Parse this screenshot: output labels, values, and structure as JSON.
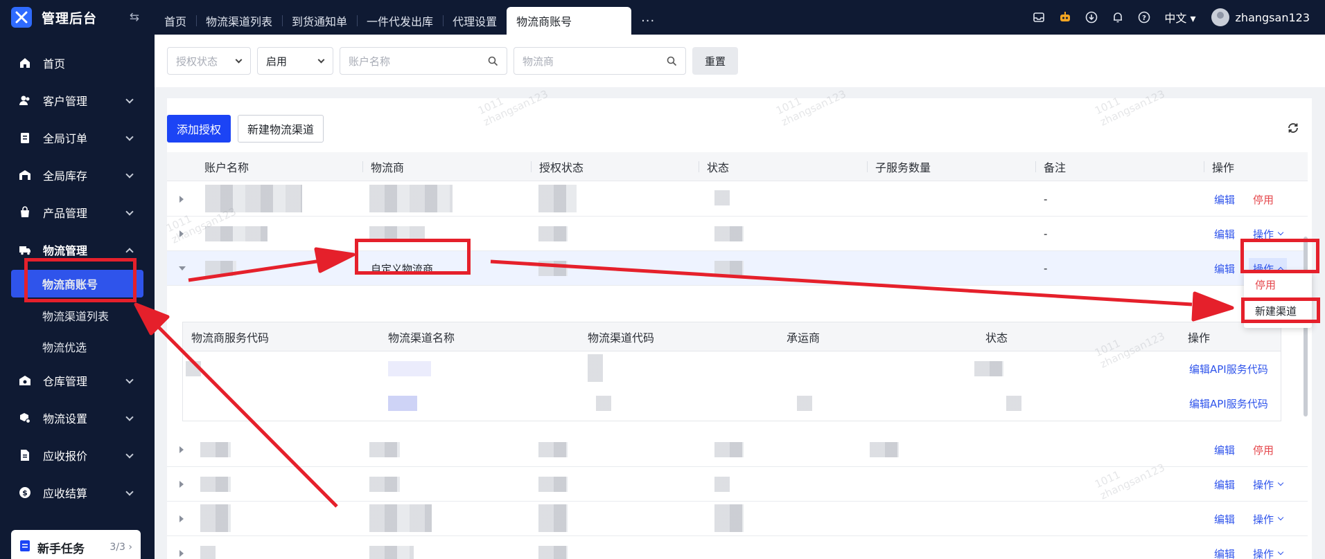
{
  "app": {
    "title": "管理后台"
  },
  "tabs": [
    {
      "label": "首页"
    },
    {
      "label": "物流渠道列表"
    },
    {
      "label": "到货通知单"
    },
    {
      "label": "一件代发出库"
    },
    {
      "label": "代理设置"
    },
    {
      "label": "物流商账号",
      "active": true
    }
  ],
  "header": {
    "language": "中文",
    "username": "zhangsan123"
  },
  "sidebar": {
    "items": [
      {
        "label": "首页",
        "icon": "home-icon"
      },
      {
        "label": "客户管理",
        "icon": "users-icon"
      },
      {
        "label": "全局订单",
        "icon": "clipboard-icon"
      },
      {
        "label": "全局库存",
        "icon": "warehouse-icon"
      },
      {
        "label": "产品管理",
        "icon": "bag-icon"
      },
      {
        "label": "物流管理",
        "icon": "truck-icon",
        "open": true
      },
      {
        "label": "仓库管理",
        "icon": "storehouse-icon"
      },
      {
        "label": "物流设置",
        "icon": "box-gear-icon"
      },
      {
        "label": "应收报价",
        "icon": "document-icon"
      },
      {
        "label": "应收结算",
        "icon": "coin-icon"
      }
    ],
    "sub_items": [
      {
        "label": "物流商账号",
        "active": true
      },
      {
        "label": "物流渠道列表"
      },
      {
        "label": "物流优选"
      }
    ],
    "task": {
      "label": "新手任务",
      "count": "3/3"
    }
  },
  "filters": {
    "auth_status_placeholder": "授权状态",
    "status_value": "启用",
    "account_placeholder": "账户名称",
    "carrier_placeholder": "物流商",
    "reset_label": "重置"
  },
  "toolbar": {
    "add_auth_label": "添加授权",
    "new_channel_label": "新建物流渠道"
  },
  "table": {
    "columns": [
      "账户名称",
      "物流商",
      "授权状态",
      "状态",
      "子服务数量",
      "备注",
      "操作"
    ],
    "remark_placeholder": "-",
    "edit_label": "编辑",
    "disable_label": "停用",
    "op_label": "操作",
    "custom_carrier": "自定义物流商"
  },
  "subtable": {
    "columns": [
      "物流商服务代码",
      "物流渠道名称",
      "物流渠道代码",
      "承运商",
      "状态",
      "操作"
    ],
    "edit_api_label": "编辑API服务代码"
  },
  "dropdown": {
    "items": [
      "停用",
      "新建渠道"
    ]
  },
  "watermark": {
    "line1": "1011",
    "line2": "zhangsan123"
  },
  "colors": {
    "primary": "#1c44f5",
    "sidebar": "#0f1a33",
    "danger": "#e5484d",
    "annotation": "#e5202b"
  }
}
